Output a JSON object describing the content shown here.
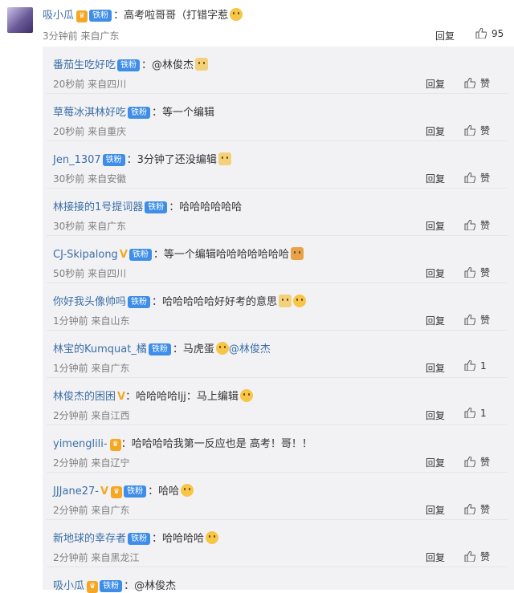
{
  "top": {
    "user": "吸小瓜",
    "badge": "铁粉",
    "text": "：高考啦哥哥（打错字惹",
    "meta": "3分钟前 来自广东",
    "reply": "回复",
    "likes": "95"
  },
  "replies": [
    {
      "user": "番茄生吃好吃",
      "badge": "铁粉",
      "text": "：@林俊杰",
      "meta": "20秒前 来自四川",
      "reply": "回复",
      "like": "赞"
    },
    {
      "user": "草莓冰淇林好吃",
      "badge": "铁粉",
      "text": "：等一个编辑",
      "meta": "20秒前 来自重庆",
      "reply": "回复",
      "like": "赞"
    },
    {
      "user": "Jen_1307",
      "badge": "铁粉",
      "text": "：3分钟了还没编辑",
      "meta": "30秒前 来自安徽",
      "reply": "回复",
      "like": "赞"
    },
    {
      "user": "林接接的1号提词器",
      "badge": "铁粉",
      "text": "：哈哈哈哈哈哈",
      "meta": "30秒前 来自广东",
      "reply": "回复",
      "like": "赞"
    },
    {
      "user": "CJ-Skipalong",
      "badge": "铁粉",
      "text": "：等一个编辑哈哈哈哈哈哈哈",
      "meta": "50秒前 来自四川",
      "reply": "回复",
      "like": "赞"
    },
    {
      "user": "你好我头像帅吗",
      "badge": "铁粉",
      "text": "：哈哈哈哈哈好好考的意思",
      "meta": "1分钟前 来自山东",
      "reply": "回复",
      "like": "赞"
    },
    {
      "user": "林宝的Kumquat_橘",
      "badge": "铁粉",
      "text": "：马虎蛋",
      "mention": "@林俊杰",
      "meta": "1分钟前 来自广东",
      "reply": "回复",
      "like": "1"
    },
    {
      "user": "林俊杰的困困",
      "badge": "",
      "text": "：哈哈哈哈ljj：马上编辑",
      "meta": "2分钟前 来自江西",
      "reply": "回复",
      "like": "1"
    },
    {
      "user": "yimenglili-",
      "badge": "",
      "text": "：哈哈哈哈我第一反应也是 高考！哥！！",
      "meta": "2分钟前 来自辽宁",
      "reply": "回复",
      "like": "赞"
    },
    {
      "user": "JJJane27-",
      "badge": "铁粉",
      "text": "：哈哈",
      "meta": "2分钟前 来自广东",
      "reply": "回复",
      "like": "赞"
    },
    {
      "user": "新地球的幸存者",
      "badge": "铁粉",
      "text": "：哈哈哈哈",
      "meta": "2分钟前 来自黑龙江",
      "reply": "回复",
      "like": "赞"
    },
    {
      "user": "吸小瓜",
      "badge": "铁粉",
      "text": "：@林俊杰",
      "meta": "",
      "reply": "",
      "like": ""
    }
  ]
}
